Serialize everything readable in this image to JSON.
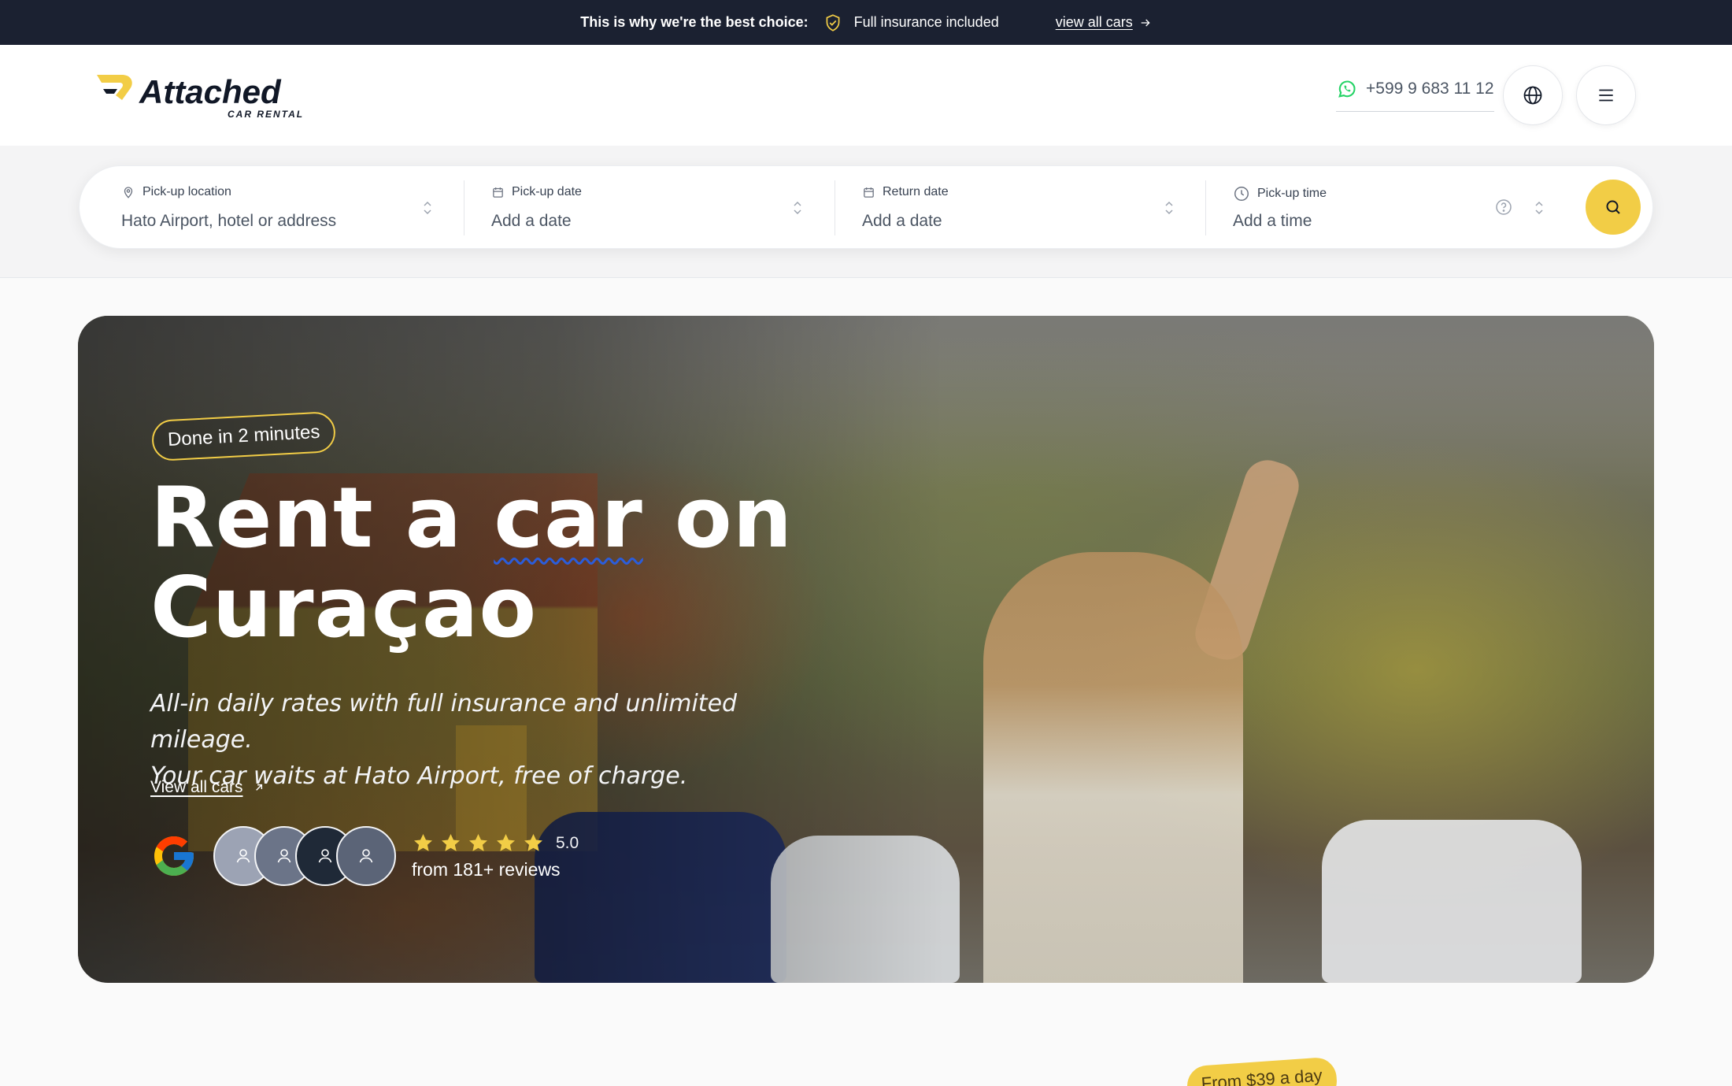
{
  "topbar": {
    "lead": "This is why we're the best choice:",
    "feature": "Full insurance included",
    "link": "view all cars"
  },
  "header": {
    "logo_word": "Attached",
    "logo_sub": "CAR RENTAL",
    "phone": "+599 9 683 11 12"
  },
  "booking": {
    "pickup_location": {
      "label": "Pick-up location",
      "value": "Hato Airport, hotel or address"
    },
    "pickup_date": {
      "label": "Pick-up date",
      "value": "Add a date"
    },
    "return_date": {
      "label": "Return date",
      "value": "Add a date"
    },
    "pickup_time": {
      "label": "Pick-up time",
      "value": "Add a time"
    }
  },
  "hero": {
    "badge": "Done in 2 minutes",
    "title": {
      "w1": "Rent",
      "w2": "a",
      "w3": "car",
      "w4": "on",
      "w5": "Curaçao"
    },
    "subtitle_line1": "All-in daily rates with full insurance and unlimited mileage.",
    "subtitle_line2": "Your car waits at Hato Airport, free of charge.",
    "link": "View all cars",
    "rating": "5.0",
    "stars": 5,
    "review_count": "from 181+ reviews"
  },
  "price_tag": "From $39 a day",
  "colors": {
    "accent_yellow": "#f2cd46",
    "topbar_bg": "#1b2131",
    "underline_blue": "#2b5ddb",
    "whatsapp_green": "#25d366"
  },
  "icons": {
    "topbar_shield": "shield-check-icon",
    "topbar_arrow": "arrow-right-icon",
    "phone": "whatsapp-icon",
    "language": "globe-icon",
    "menu": "hamburger-menu-icon",
    "location": "map-pin-icon",
    "calendar": "calendar-icon",
    "time": "clock-icon",
    "help": "question-circle-icon",
    "search": "search-icon",
    "external": "arrow-up-right-icon",
    "google": "google-icon"
  }
}
